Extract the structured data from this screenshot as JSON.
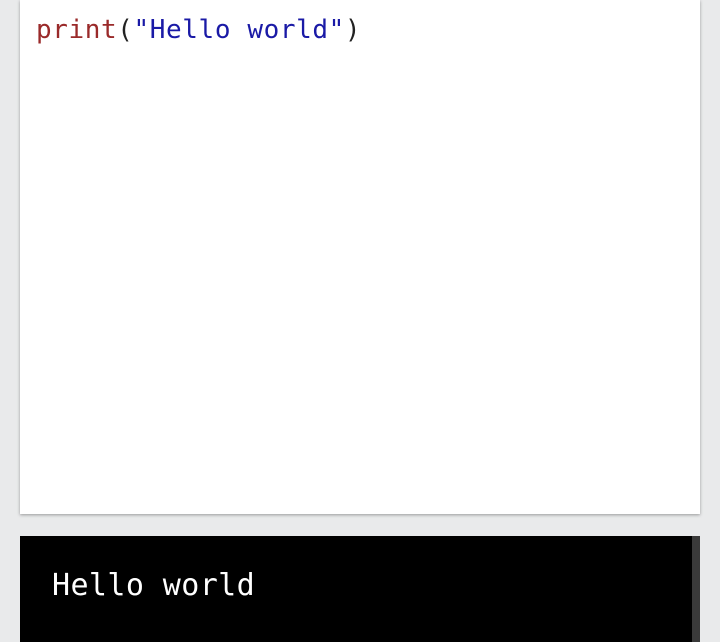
{
  "editor": {
    "code": {
      "function_name": "print",
      "open_paren": "(",
      "string_literal": "\"Hello world\"",
      "close_paren": ")"
    }
  },
  "console": {
    "output": "Hello world"
  },
  "colors": {
    "builtin": "#9a2a2a",
    "string": "#1a1aa6",
    "console_background": "#000000",
    "console_text": "#ffffff"
  }
}
